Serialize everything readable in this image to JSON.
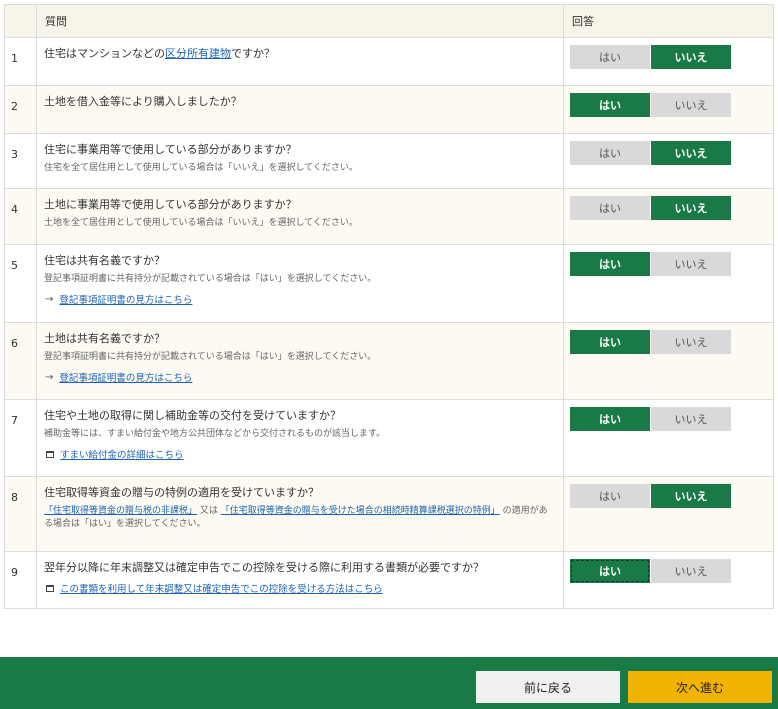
{
  "header": {
    "question_col": "質問",
    "answer_col": "回答"
  },
  "answer_labels": {
    "yes": "はい",
    "no": "いいえ"
  },
  "rows": [
    {
      "num": "1",
      "text_pre": "住宅はマンションなどの",
      "text_link": "区分所有建物",
      "text_post": "ですか？",
      "selected": "no"
    },
    {
      "num": "2",
      "text": "土地を借入金等により購入しましたか？",
      "selected": "yes"
    },
    {
      "num": "3",
      "text": "住宅に事業用等で使用している部分がありますか？",
      "note": "住宅を全て居住用として使用している場合は「いいえ」を選択してください。",
      "selected": "no"
    },
    {
      "num": "4",
      "text": "土地に事業用等で使用している部分がありますか？",
      "note": "土地を全て居住用として使用している場合は「いいえ」を選択してください。",
      "selected": "no"
    },
    {
      "num": "5",
      "text": "住宅は共有名義ですか？",
      "note": "登記事項証明書に共有持分が記載されている場合は「はい」を選択してください。",
      "link": "登記事項証明書の見方はこちら",
      "selected": "yes"
    },
    {
      "num": "6",
      "text": "土地は共有名義ですか？",
      "note": "登記事項証明書に共有持分が記載されている場合は「はい」を選択してください。",
      "link": "登記事項証明書の見方はこちら",
      "selected": "yes"
    },
    {
      "num": "7",
      "text": "住宅や土地の取得に関し補助金等の交付を受けていますか？",
      "note": "補助金等には、すまい給付金や地方公共団体などから交付されるものが該当します。",
      "link": "すまい給付金の詳細はこちら",
      "selected": "yes"
    },
    {
      "num": "8",
      "text": "住宅取得等資金の贈与の特例の適用を受けていますか？",
      "note_link1": "「住宅取得等資金の贈与税の非課税」",
      "note_mid": "又は",
      "note_link2": "「住宅取得等資金の贈与を受けた場合の相続時精算課税選択の特例」",
      "note_post": "の適用がある場合は「はい」を選択してください。",
      "selected": "no"
    },
    {
      "num": "9",
      "text": "翌年分以降に年末調整又は確定申告でこの控除を受ける際に利用する書類が必要ですか？",
      "link": "この書類を利用して年末調整又は確定申告でこの控除を受ける方法はこちら",
      "selected": "yes"
    }
  ],
  "footer": {
    "back_label": "前に戻る",
    "next_label": "次へ進む"
  },
  "colors": {
    "selected": "#1a7a47",
    "unselected": "#d9d9d9",
    "footer_bg": "#1a7a47",
    "next_button": "#f2b200",
    "link": "#1e63b0"
  }
}
